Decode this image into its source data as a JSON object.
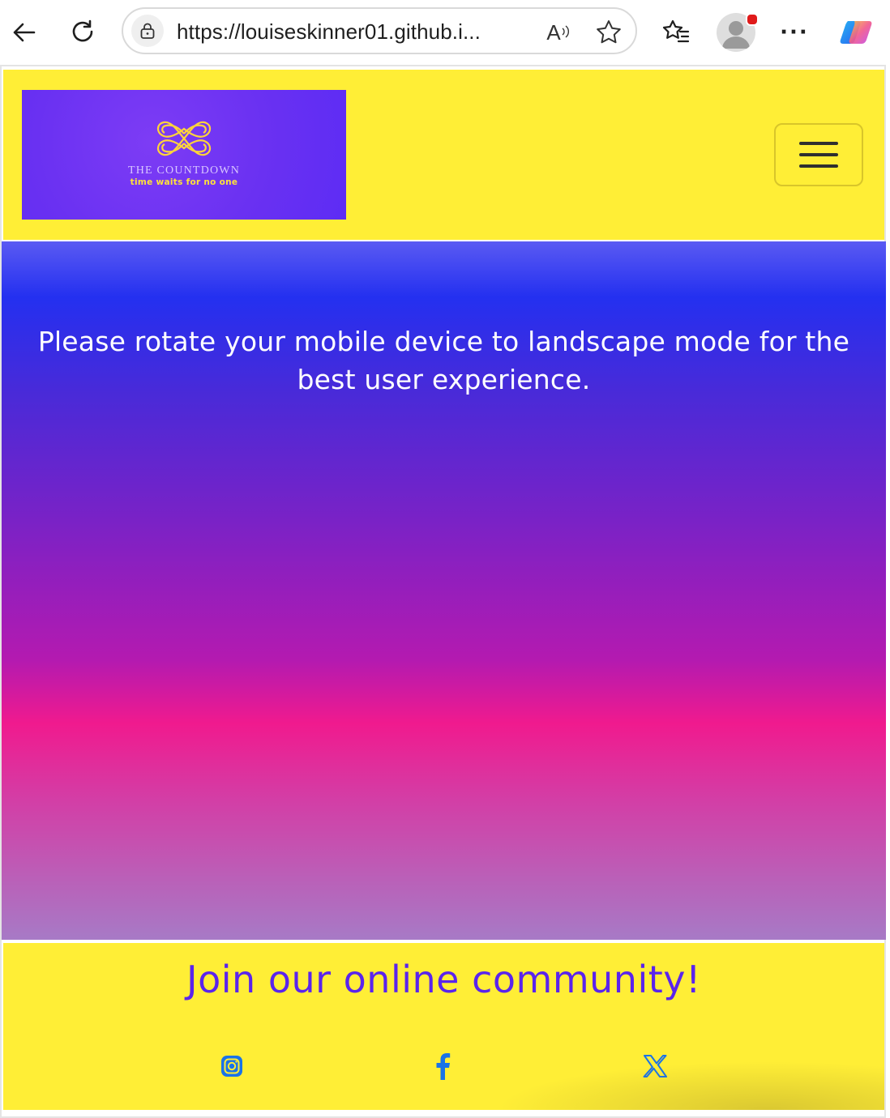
{
  "browser": {
    "url": "https://louiseskinner01.github.i...",
    "read_aloud_glyph": "A",
    "more_glyph": "···"
  },
  "header": {
    "logo": {
      "title": "THE COUNTDOWN",
      "tagline": "time waits for no one"
    },
    "menu_icon": "hamburger-icon"
  },
  "hero": {
    "message": "Please rotate your mobile device to landscape mode for the best user experience."
  },
  "footer": {
    "title": "Join our online community!",
    "social": [
      "instagram-icon",
      "facebook-icon",
      "x-icon"
    ]
  },
  "colors": {
    "header_bg": "#ffee36",
    "brand_purple": "#5a24ec",
    "social_blue": "#1a73e8"
  }
}
